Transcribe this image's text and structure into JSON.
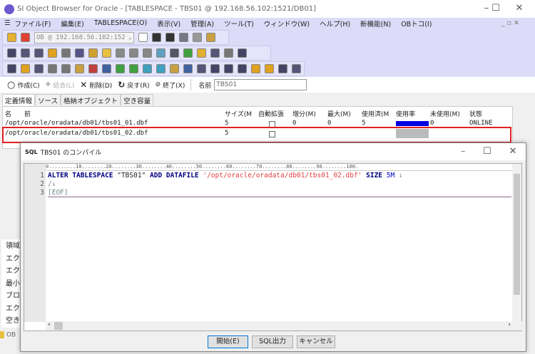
{
  "window": {
    "title": "SI Object Browser for Oracle - [TABLESPACE - TBS01 @ 192.168.56.102:1521/DB01]"
  },
  "menu": [
    "ファイル(F)",
    "編集(E)",
    "TABLESPACE(O)",
    "表示(V)",
    "管理(A)",
    "ツール(T)",
    "ウィンドウ(W)",
    "ヘルプ(H)",
    "新機能(N)",
    "OBトコ(I)"
  ],
  "toolbar": {
    "connection": "OB @ 192.168.56.102:152",
    "row1_icons": [
      [
        "add-connection-icon",
        "#e8b030"
      ],
      [
        "remove-connection-icon",
        "#e04030"
      ]
    ],
    "row1b_icons": [
      [
        "circle-icon",
        "#fff"
      ],
      [
        "refresh-icon",
        "#333"
      ],
      [
        "undo-icon",
        "#333"
      ],
      [
        "cut-icon",
        "#778"
      ],
      [
        "copy-icon",
        "#999"
      ],
      [
        "paste-icon",
        "#c8a040"
      ]
    ],
    "row2_icons": [
      [
        "sql-icon",
        "#446"
      ],
      [
        "script-icon",
        "#557"
      ],
      [
        "table-view-icon",
        "#557"
      ],
      [
        "user-icon",
        "#e0a020"
      ],
      [
        "database-icon",
        "#777"
      ],
      [
        "computer-icon",
        "#558"
      ],
      [
        "lock-icon",
        "#d0a030"
      ],
      [
        "cylinder-icon",
        "#e8c040"
      ],
      [
        "page-icon",
        "#888"
      ],
      [
        "rect-icon",
        "#888"
      ],
      [
        "copy-doc-icon",
        "#888"
      ],
      [
        "recycle-icon",
        "#60a0c0"
      ],
      [
        "clock-icon",
        "#556"
      ],
      [
        "sync-icon",
        "#40a040"
      ],
      [
        "report-icon",
        "#e0b030"
      ],
      [
        "monitor-icon",
        "#557"
      ],
      [
        "chat-icon",
        "#777"
      ],
      [
        "export-icon",
        "#446"
      ]
    ],
    "row3_icons": [
      [
        "grid-icon",
        "#446"
      ],
      [
        "key-icon",
        "#e0a020"
      ],
      [
        "calendar-icon",
        "#557"
      ],
      [
        "package-icon",
        "#777"
      ],
      [
        "stack-icon",
        "#777"
      ],
      [
        "folder-icon",
        "#c8a040"
      ],
      [
        "table-red-icon",
        "#c04040"
      ],
      [
        "table-icon",
        "#4060a0"
      ],
      [
        "table2-icon",
        "#40a040"
      ],
      [
        "table3-icon",
        "#40a040"
      ],
      [
        "column-add-icon",
        "#40a0c0"
      ],
      [
        "column-icon",
        "#40a0c0"
      ],
      [
        "star-icon",
        "#c8a040"
      ],
      [
        "number-icon",
        "#4060a0"
      ],
      [
        "window-icon",
        "#557"
      ],
      [
        "arrow-icon",
        "#446"
      ],
      [
        "form-icon",
        "#446"
      ],
      [
        "form2-icon",
        "#446"
      ],
      [
        "loop-icon",
        "#e0a020"
      ],
      [
        "wand-icon",
        "#e0a020"
      ],
      [
        "book-icon",
        "#446"
      ],
      [
        "light-icon",
        "#557"
      ]
    ]
  },
  "objbar": {
    "create": "作成(C)",
    "join": "結合(L)",
    "delete": "削除(D)",
    "revert": "戻す(R)",
    "exit": "終了(X)",
    "name_label": "名前",
    "name_value": "TBS01"
  },
  "tabs": [
    "定義情報",
    "ソース",
    "格納オブジェクト",
    "空き容量"
  ],
  "grid": {
    "headers": [
      "名　　前",
      "サイズ(M",
      "自動拡張",
      "増分(M)",
      "最大(M)",
      "使用済(M",
      "使用率",
      "未使用(M)",
      "状態"
    ],
    "rows": [
      {
        "name": "/opt/oracle/oradata/db01/tbs01_01.dbf",
        "size": "5",
        "inc": "0",
        "max": "0",
        "used": "5",
        "unused": "0",
        "status": "ONLINE",
        "usage": 1.0
      },
      {
        "name": "/opt/oracle/oradata/db01/tbs01_02.dbf",
        "size": "5",
        "inc": "",
        "max": "",
        "used": "",
        "unused": "",
        "status": "",
        "usage": null
      }
    ]
  },
  "left_labels": [
    "領域",
    "エク",
    "エク",
    "最小",
    "ブロ",
    "エク",
    "空き"
  ],
  "status": "OB",
  "dialog": {
    "title": "TBS01 のコンパイル",
    "ruler": "0.........10........20........30........40........50........60........70........80........90........100.",
    "lines": [
      "1",
      "2",
      "3"
    ],
    "code": {
      "kw1": "ALTER TABLESPACE",
      "id": " \"TBS01\" ",
      "kw2": "ADD DATAFILE",
      "str": " '/opt/oracle/oradata/db01/tbs01_02.dbf' ",
      "kw3": "SIZE",
      "num": " 5M",
      "eol": " ↓",
      "line2": "/↓",
      "line3": "[EOF]"
    },
    "buttons": {
      "start": "開始(E)",
      "sql": "SQL出力",
      "cancel": "キャンセル"
    }
  }
}
